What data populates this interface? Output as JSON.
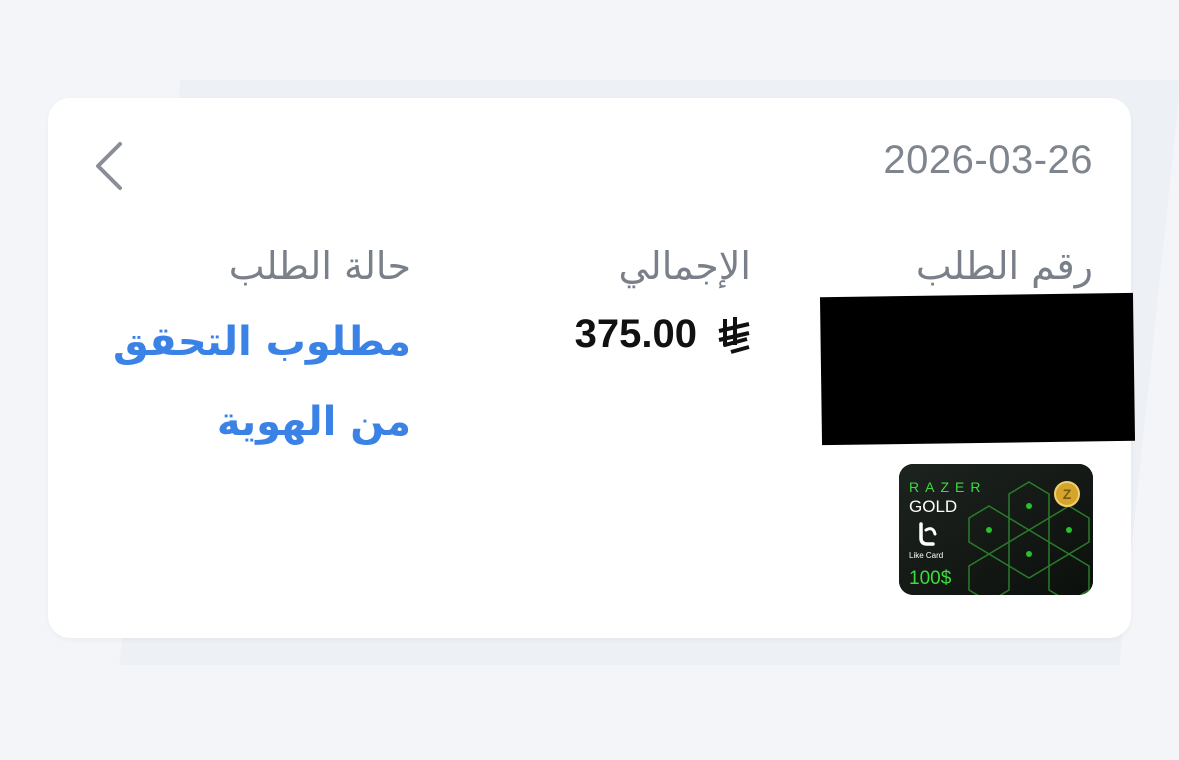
{
  "order": {
    "date": "2026-03-26",
    "labels": {
      "order_number": "رقم الطلب",
      "total": "الإجمالي",
      "status": "حالة الطلب"
    },
    "total_amount": "375.00",
    "currency_icon": "saudi-riyal-icon",
    "status_text_line1": "مطلوب التحقق",
    "status_text_line2": "من الهوية",
    "status_color": "#3b82e6"
  },
  "product": {
    "brand": "RAZER",
    "brand_line2": "GOLD",
    "seller": "Like Card",
    "value": "100$",
    "accent_color": "#3ddc3d"
  },
  "icons": {
    "back": "chevron-left-icon"
  }
}
